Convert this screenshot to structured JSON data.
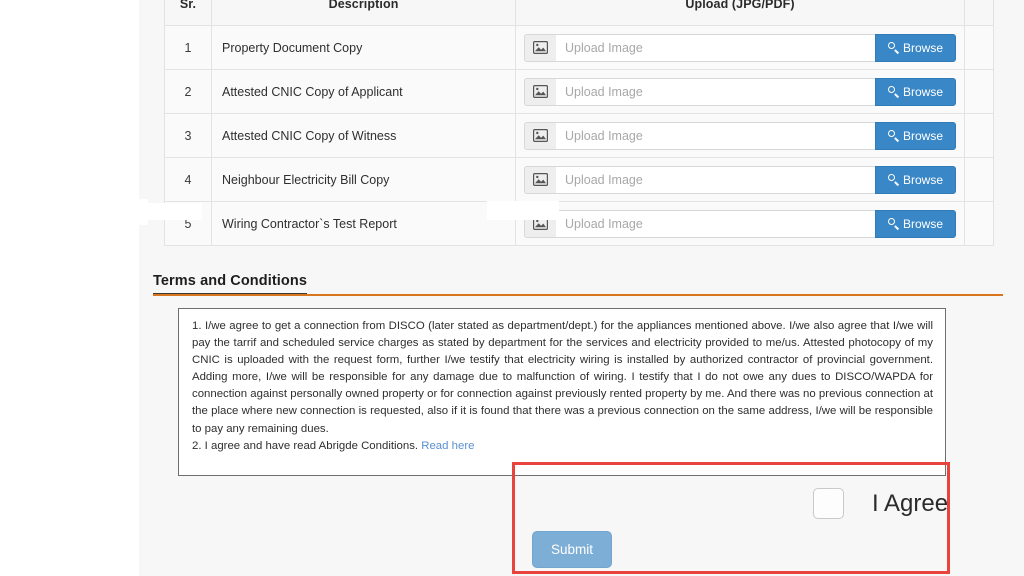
{
  "documents_table": {
    "columns": [
      "Sr.",
      "Description",
      "Upload (JPG/PDF)",
      ""
    ],
    "rows": [
      {
        "sr": "1",
        "description": "Property Document Copy",
        "upload_placeholder": "Upload Image",
        "browse_label": "Browse"
      },
      {
        "sr": "2",
        "description": "Attested CNIC Copy of Applicant",
        "upload_placeholder": "Upload Image",
        "browse_label": "Browse"
      },
      {
        "sr": "3",
        "description": "Attested CNIC Copy of Witness",
        "upload_placeholder": "Upload Image",
        "browse_label": "Browse"
      },
      {
        "sr": "4",
        "description": "Neighbour Electricity Bill Copy",
        "upload_placeholder": "Upload Image",
        "browse_label": "Browse"
      },
      {
        "sr": "5",
        "description": "Wiring Contractor`s Test Report",
        "upload_placeholder": "Upload Image",
        "browse_label": "Browse"
      }
    ]
  },
  "terms": {
    "heading": "Terms and Conditions",
    "paragraph_1": "1. I/we agree to get a connection from DISCO (later stated as department/dept.) for the appliances mentioned above. I/we also agree that I/we will pay the tarrif and scheduled service charges as stated by department for the services and electricity provided to me/us. Attested photocopy of my CNIC is uploaded with the request form, further I/we testify that electricity wiring is installed by authorized contractor of provincial government. Adding more, I/we will be responsible for any damage due to malfunction of wiring. I testify that I do not owe any dues to DISCO/WAPDA for connection against personally owned property or for connection against previously rented property by me. And there was no previous connection at the place where new connection is requested, also if it is found that there was a previous connection on the same address, I/we will be responsible to pay any remaining dues.",
    "paragraph_2_text": "2. I agree and have read Abrigde Conditions. ",
    "paragraph_2_link": "Read here"
  },
  "agreement": {
    "checkbox_checked": false,
    "label": "I Agree",
    "submit_label": "Submit"
  },
  "colors": {
    "browse_button": "#3a87c8",
    "submit_button": "#7daed6",
    "heading_rule": "#d9741f",
    "highlight_box": "#e8433c",
    "link": "#5a8fd0"
  }
}
